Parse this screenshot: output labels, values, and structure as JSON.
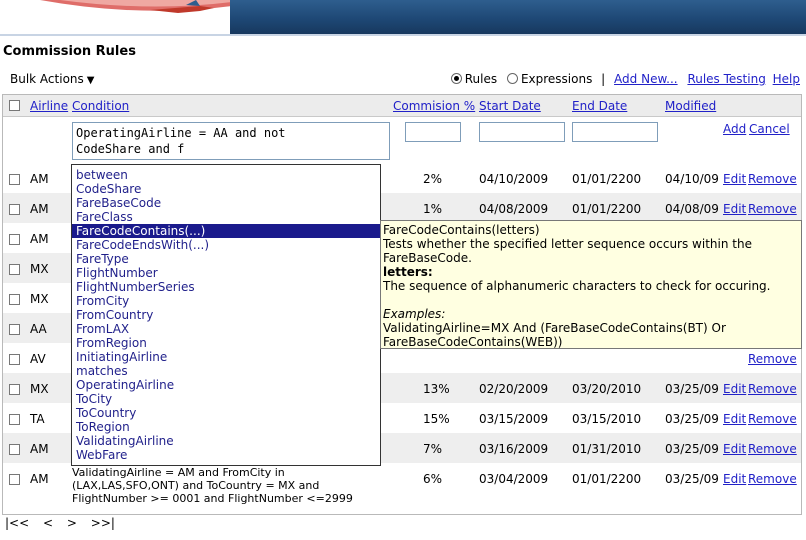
{
  "page_title": "Commission Rules",
  "toolbar": {
    "bulk_actions": "Bulk Actions",
    "view_options": [
      {
        "label": "Rules",
        "selected": true
      },
      {
        "label": "Expressions",
        "selected": false
      }
    ],
    "add_new": "Add New...",
    "rules_testing": "Rules Testing",
    "help": "Help"
  },
  "table": {
    "headers": {
      "airline": "Airline",
      "condition": "Condition",
      "commission": "Commision %",
      "start_date": "Start Date",
      "end_date": "End Date",
      "modified": "Modified"
    },
    "edit_row": {
      "condition_value": "OperatingAirline = AA and not\nCodeShare and f",
      "add": "Add",
      "cancel": "Cancel"
    },
    "rows": [
      {
        "airline": "AM",
        "condition": "",
        "commission": "2%",
        "start": "04/10/2009",
        "end": "01/01/2200",
        "modified": "04/10/09",
        "edit": "Edit",
        "remove": "Remove"
      },
      {
        "airline": "AM",
        "condition": "",
        "commission": "1%",
        "start": "04/08/2009",
        "end": "01/01/2200",
        "modified": "04/08/09",
        "edit": "Edit",
        "remove": "Remove"
      },
      {
        "airline": "AM",
        "condition": "",
        "commission": "",
        "start": "",
        "end": "",
        "modified": "",
        "edit": "",
        "remove": ""
      },
      {
        "airline": "MX",
        "condition": "",
        "commission": "",
        "start": "",
        "end": "",
        "modified": "",
        "edit": "",
        "remove": ""
      },
      {
        "airline": "MX",
        "condition": "",
        "commission": "",
        "start": "",
        "end": "",
        "modified": "",
        "edit": "",
        "remove": ""
      },
      {
        "airline": "AA",
        "condition": "",
        "commission": "",
        "start": "",
        "end": "",
        "modified": "",
        "edit": "",
        "remove": ""
      },
      {
        "airline": "AV",
        "condition": "",
        "commission": "",
        "start": "",
        "end": "",
        "modified": "",
        "edit": "",
        "remove": "Remove"
      },
      {
        "airline": "MX",
        "condition": "",
        "commission": "13%",
        "start": "02/20/2009",
        "end": "03/20/2010",
        "modified": "03/25/09",
        "edit": "Edit",
        "remove": "Remove"
      },
      {
        "airline": "TA",
        "condition": "",
        "commission": "15%",
        "start": "03/15/2009",
        "end": "03/15/2010",
        "modified": "03/25/09",
        "edit": "Edit",
        "remove": "Remove"
      },
      {
        "airline": "AM",
        "condition": "",
        "commission": "7%",
        "start": "03/16/2009",
        "end": "01/31/2010",
        "modified": "03/25/09",
        "edit": "Edit",
        "remove": "Remove"
      },
      {
        "airline": "AM",
        "condition": "ValidatingAirline = AM and FromCity in\n(LAX,LAS,SFO,ONT) and ToCountry = MX and\nFlightNumber >= 0001 and FlightNumber <=2999",
        "commission": "6%",
        "start": "03/04/2009",
        "end": "01/01/2200",
        "modified": "03/25/09",
        "edit": "Edit",
        "remove": "Remove"
      }
    ]
  },
  "pager": [
    "|<<",
    "<",
    ">",
    ">>|"
  ],
  "autocomplete": {
    "options": [
      "between",
      "CodeShare",
      "FareBaseCode",
      "FareClass",
      "FareCodeContains(...)",
      "FareCodeEndsWith(...)",
      "FareType",
      "FlightNumber",
      "FlightNumberSeries",
      "FromCity",
      "FromCountry",
      "FromLAX",
      "FromRegion",
      "InitiatingAirline",
      "matches",
      "OperatingAirline",
      "ToCity",
      "ToCountry",
      "ToRegion",
      "ValidatingAirline",
      "WebFare"
    ],
    "selected_index": 4
  },
  "tooltip": {
    "signature": "FareCodeContains(letters)",
    "description": "Tests whether the specified letter sequence occurs within the FareBaseCode.",
    "param_name": "letters:",
    "param_desc": "The sequence of alphanumeric characters to check for occuring.",
    "examples_label": "Examples:",
    "example": "ValidatingAirline=MX And (FareBaseCodeContains(BT) Or FareBaseCodeContains(WEB))"
  },
  "colors": {
    "banner": "#1d4673",
    "link": "#2121c8",
    "selection": "#1a1a8c",
    "tooltip_bg": "#ffffe1"
  }
}
